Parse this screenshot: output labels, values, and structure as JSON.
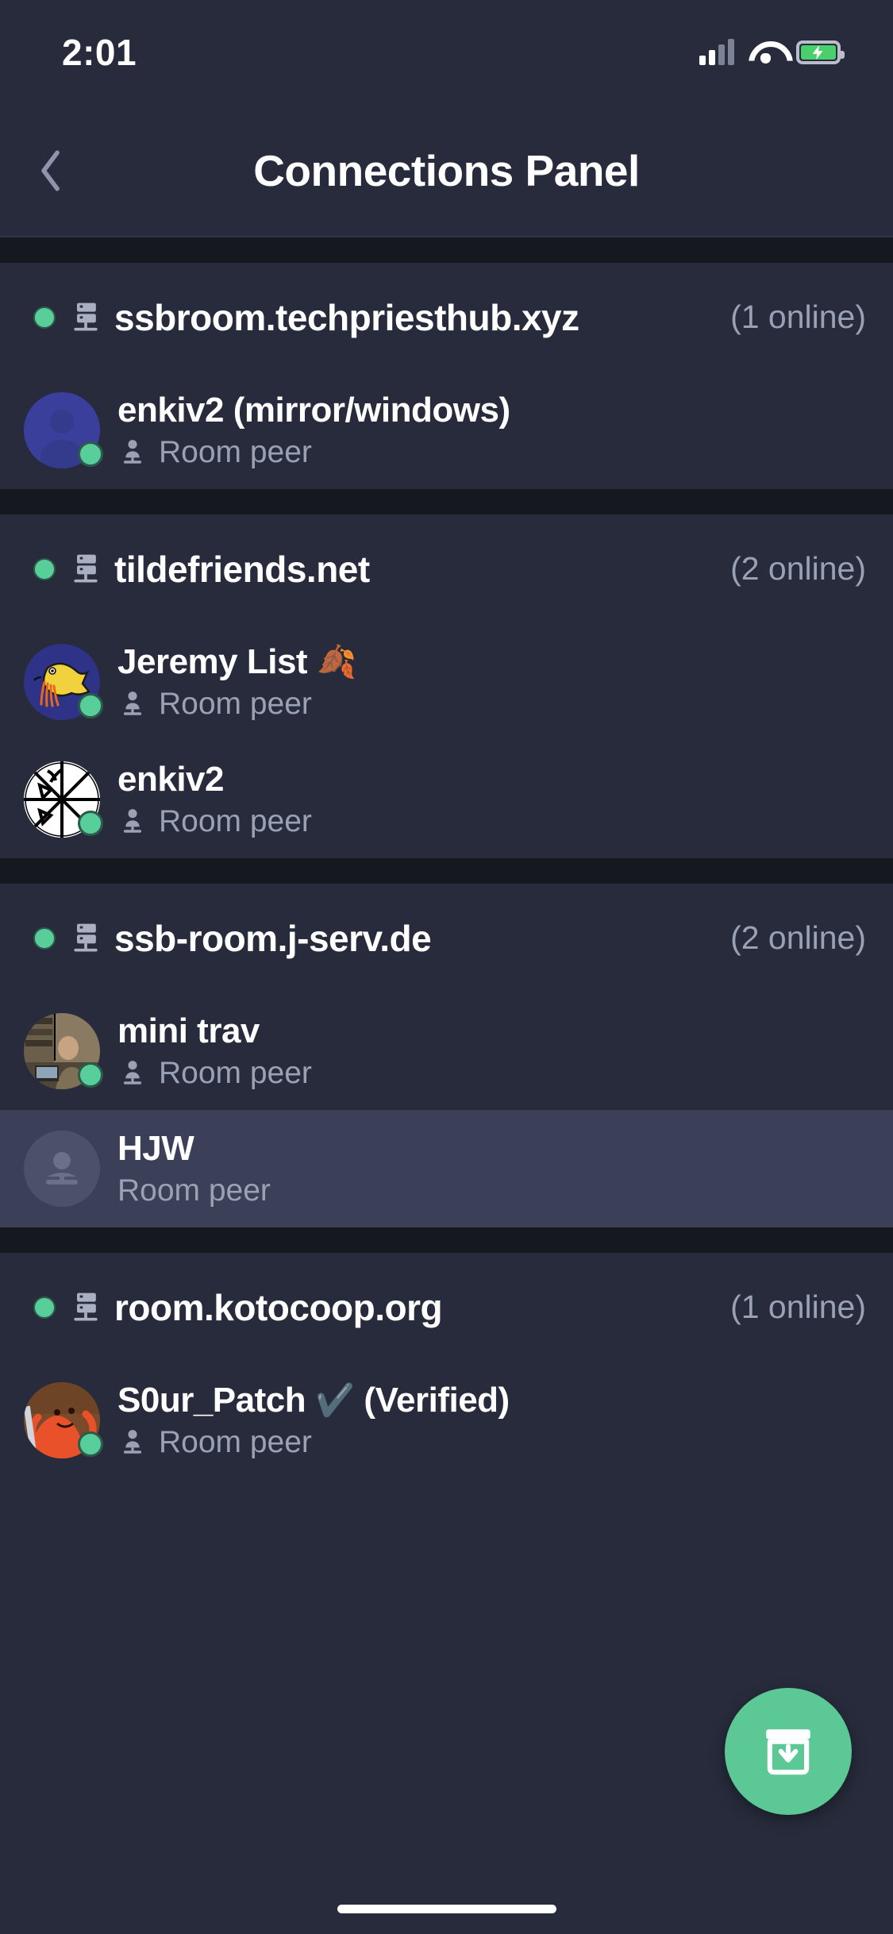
{
  "status_bar": {
    "time": "2:01",
    "cellular_icon": "cellular-signal-icon",
    "wifi_icon": "wifi-icon",
    "battery_icon": "battery-charging-icon",
    "battery_color": "#4ad06a"
  },
  "header": {
    "back_icon": "chevron-left-icon",
    "title": "Connections Panel"
  },
  "theme": {
    "background": "#272b3b",
    "gap": "#16181f",
    "selected_row": "#3b3f57",
    "online_green": "#58cf9b",
    "fab_green": "#5bc896",
    "muted_text": "#9ba1b5"
  },
  "sections": [
    {
      "server": {
        "status_icon": "online-dot-icon",
        "icon": "server-rack-icon",
        "name": "ssbroom.techpriesthub.xyz",
        "online_count": "(1 online)"
      },
      "peers": [
        {
          "avatar_type": "default-person-avatar",
          "name": "enkiv2 (mirror/windows)",
          "emoji": "",
          "role_icon": "room-peer-icon",
          "role": "Room peer",
          "online": true,
          "selected": false
        }
      ]
    },
    {
      "server": {
        "status_icon": "online-dot-icon",
        "icon": "server-rack-icon",
        "name": "tildefriends.net",
        "online_count": "(2 online)"
      },
      "peers": [
        {
          "avatar_type": "yellow-creature-avatar",
          "name": "Jeremy List",
          "emoji": "🍂",
          "role_icon": "room-peer-icon",
          "role": "Room peer",
          "online": true,
          "selected": false
        },
        {
          "avatar_type": "white-pinwheel-avatar",
          "name": "enkiv2",
          "emoji": "",
          "role_icon": "room-peer-icon",
          "role": "Room peer",
          "online": true,
          "selected": false
        }
      ]
    },
    {
      "server": {
        "status_icon": "online-dot-icon",
        "icon": "server-rack-icon",
        "name": "ssb-room.j-serv.de",
        "online_count": "(2 online)"
      },
      "peers": [
        {
          "avatar_type": "photo-person-avatar",
          "name": "mini trav",
          "emoji": "",
          "role_icon": "room-peer-icon",
          "role": "Room peer",
          "online": true,
          "selected": false
        },
        {
          "avatar_type": "placeholder-avatar",
          "name": "HJW",
          "emoji": "",
          "role_icon": "",
          "role": "Room peer",
          "online": false,
          "selected": true
        }
      ]
    },
    {
      "server": {
        "status_icon": "online-dot-icon",
        "icon": "server-rack-icon",
        "name": "room.kotocoop.org",
        "online_count": "(1 online)"
      },
      "peers": [
        {
          "avatar_type": "orange-creature-avatar",
          "name": "S0ur_Patch",
          "emoji": "✔️",
          "name_suffix": "(Verified)",
          "role_icon": "room-peer-icon",
          "role": "Room peer",
          "online": true,
          "selected": false
        }
      ]
    }
  ],
  "fab": {
    "icon": "archive-download-icon",
    "label": ""
  },
  "home_indicator": "home-indicator-bar"
}
